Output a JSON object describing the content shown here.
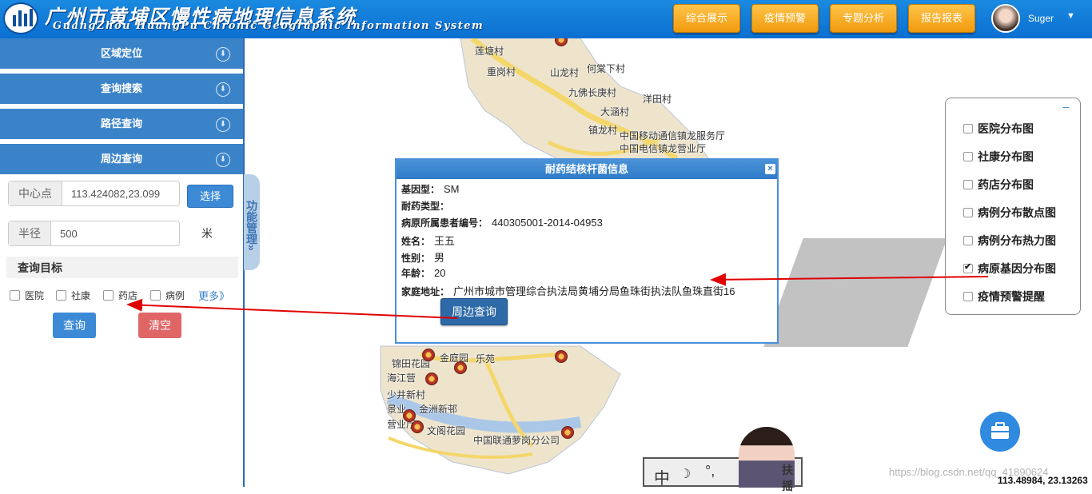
{
  "app": {
    "title": "广州市黄埔区慢性病地理信息系统",
    "subtitle": "GuangZhou HuangPu Chronic Geographic Information System"
  },
  "nav": {
    "buttons": [
      "综合展示",
      "疫情预警",
      "专题分析",
      "报告报表"
    ],
    "user": "Suger"
  },
  "sidebar": {
    "sections": [
      "区域定位",
      "查询搜索",
      "路径查询",
      "周边查询"
    ],
    "center_label": "中心点",
    "center_value": "113.424082,23.099",
    "select_button": "选择",
    "radius_label": "半径",
    "radius_value": "500",
    "radius_unit": "米",
    "target_title": "查询目标",
    "targets": [
      "医院",
      "社康",
      "药店",
      "病例"
    ],
    "more": "更多》",
    "query_button": "查询",
    "clear_button": "清空"
  },
  "func_tab": "功能管理»",
  "map_labels": [
    "莲塘村",
    "重岗村",
    "山龙村",
    "何棠下村",
    "九佛长庚村",
    "大涵村",
    "洋田村",
    "镇龙村",
    "中国移动通信镇龙服务厅",
    "中国电信镇龙营业厅",
    "锦田花园",
    "金庭园",
    "乐苑",
    "海江营",
    "少井新村",
    "景业",
    "金洲新邨",
    "营业厅",
    "文阁花园",
    "中国联通萝岗分公司"
  ],
  "popup": {
    "title": "耐药结核杆菌信息",
    "close": "×",
    "rows": [
      {
        "key": "基因型：",
        "value": "SM"
      },
      {
        "key": "耐药类型：",
        "value": ""
      },
      {
        "key": "病原所属患者编号：",
        "value": "440305001-2014-04953"
      },
      {
        "key": "姓名：",
        "value": "王五"
      },
      {
        "key": "性别：",
        "value": "男"
      },
      {
        "key": "年龄：",
        "value": "20"
      },
      {
        "key": "家庭地址：",
        "value": "广州市城市管理综合执法局黄埔分局鱼珠街执法队鱼珠直街16"
      }
    ],
    "nearby_button": "周边查询"
  },
  "layers": {
    "collapse": "–",
    "items": [
      {
        "label": "医院分布图",
        "checked": false
      },
      {
        "label": "社康分布图",
        "checked": false
      },
      {
        "label": "药店分布图",
        "checked": false
      },
      {
        "label": "病例分布散点图",
        "checked": false
      },
      {
        "label": "病例分布热力图",
        "checked": false
      },
      {
        "label": "病原基因分布图",
        "checked": true
      },
      {
        "label": "疫情预警提醒",
        "checked": false
      }
    ]
  },
  "badge": {
    "glyph": "中",
    "dots": "°,",
    "fushang": "扶摇"
  },
  "watermark": "https://blog.csdn.net/qq_41890624",
  "coords": "113.48984, 23.13263",
  "colors": {
    "header": "#0b6fd0",
    "accent": "#3b83c9",
    "nav": "#f09a0c",
    "danger": "#e06666",
    "arrow": "#e00000"
  }
}
